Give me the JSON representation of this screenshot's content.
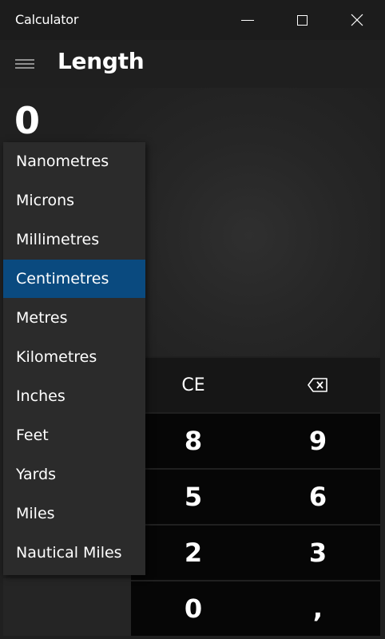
{
  "window": {
    "title": "Calculator"
  },
  "header": {
    "menu_icon": "hamburger-menu-icon",
    "title": "Length"
  },
  "display": {
    "value": "0"
  },
  "unit_dropdown": {
    "selected": "Centimetres",
    "items": [
      "Nanometres",
      "Microns",
      "Millimetres",
      "Centimetres",
      "Metres",
      "Kilometres",
      "Inches",
      "Feet",
      "Yards",
      "Miles",
      "Nautical Miles"
    ]
  },
  "keypad": {
    "clear_entry": "CE",
    "backspace_icon": "backspace-icon",
    "digit_8": "8",
    "digit_9": "9",
    "digit_5": "5",
    "digit_6": "6",
    "digit_2": "2",
    "digit_3": "3",
    "digit_0": "0",
    "decimal": ","
  },
  "colors": {
    "accent": "#0a4a7f",
    "background": "#202020",
    "digit_button": "#060606",
    "operator_button": "#161616"
  }
}
